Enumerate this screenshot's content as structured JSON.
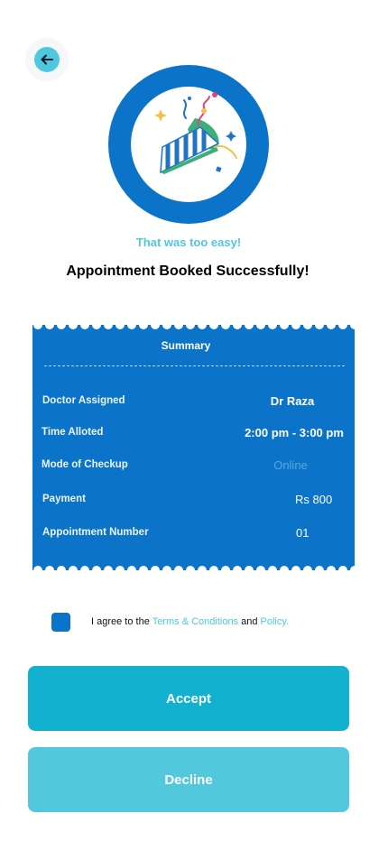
{
  "header": {
    "back_icon": "arrow-left-icon"
  },
  "hero": {
    "icon": "party-popper-icon",
    "tagline": "That was too easy!",
    "headline": "Appointment Booked Successfully!",
    "colors": {
      "ring": "#0b74c9",
      "accent": "#4fc8df"
    }
  },
  "summary": {
    "title": "Summary",
    "rows": [
      {
        "label": "Doctor Assigned",
        "value": "Dr Raza"
      },
      {
        "label": "Time Alloted",
        "value": "2:00 pm - 3:00 pm"
      },
      {
        "label": "Mode of Checkup",
        "value": "Online"
      },
      {
        "label": "Payment",
        "value": "Rs 800"
      },
      {
        "label": "Appointment Number",
        "value": "01"
      }
    ]
  },
  "agreement": {
    "prefix": "I agree to the ",
    "terms_link": "Terms & Conditions",
    "and": " and ",
    "policy_link": "Policy.",
    "checked": true
  },
  "actions": {
    "accept_label": "Accept",
    "decline_label": "Decline",
    "colors": {
      "accept": "#13b1d0",
      "decline": "#51c8dc"
    }
  }
}
